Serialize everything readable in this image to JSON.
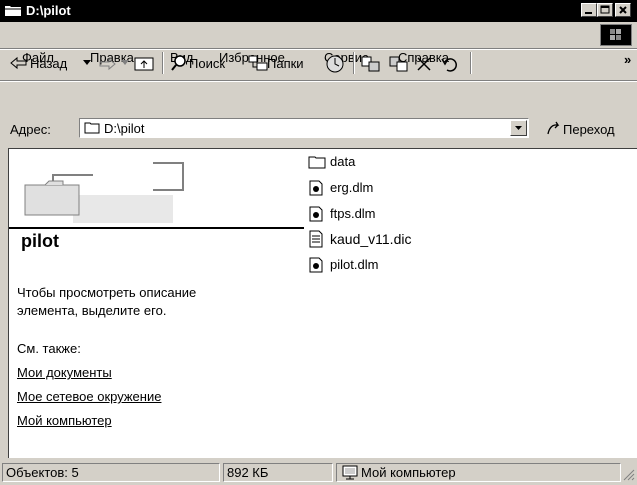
{
  "window": {
    "title": "D:\\pilot"
  },
  "menu": [
    "Файл",
    "Правка",
    "Вид",
    "Избранное",
    "Сервис",
    "Справка"
  ],
  "toolbar": {
    "back": "Назад",
    "search": "Поиск",
    "folders": "Папки",
    "more": "»"
  },
  "address": {
    "label": "Адрес:",
    "value": "D:\\pilot",
    "go": "Переход"
  },
  "left_panel": {
    "folder_name": "pilot",
    "hint": [
      "Чтобы просмотреть описание",
      "элемента, выделите его."
    ],
    "see_also": "См. также:",
    "links": [
      "Мои документы",
      "Мое сетевое окружение",
      "Мой компьютер"
    ]
  },
  "files": [
    {
      "name": "data",
      "icon": "folder-icon"
    },
    {
      "name": "erg.dlm",
      "icon": "dll-file-icon"
    },
    {
      "name": "ftps.dlm",
      "icon": "dll-file-icon"
    },
    {
      "name": "kaud_v11.dic",
      "icon": "text-file-icon"
    },
    {
      "name": "pilot.dlm",
      "icon": "dll-file-icon"
    }
  ],
  "status": {
    "objects": "Объектов: 5",
    "size": "892 КБ",
    "location": "Мой компьютер"
  }
}
